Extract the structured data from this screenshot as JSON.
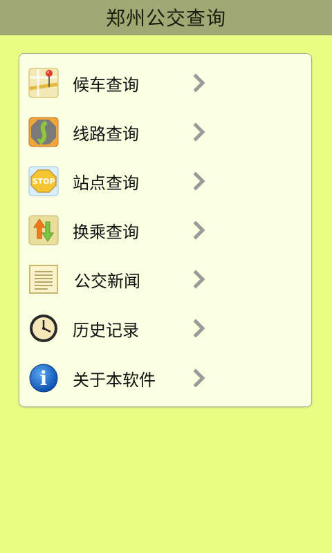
{
  "app": {
    "title": "郑州公交查询"
  },
  "menu": {
    "items": [
      {
        "label": "候车查询",
        "icon": "map-pin-icon"
      },
      {
        "label": "线路查询",
        "icon": "route-icon"
      },
      {
        "label": "站点查询",
        "icon": "stop-sign-icon",
        "icon_text": "STOP"
      },
      {
        "label": "换乘查询",
        "icon": "transfer-arrows-icon"
      },
      {
        "label": "公交新闻",
        "icon": "news-icon"
      },
      {
        "label": "历史记录",
        "icon": "clock-icon"
      },
      {
        "label": "关于本软件",
        "icon": "info-icon",
        "icon_text": "i"
      }
    ]
  },
  "colors": {
    "background": "#e8fc82",
    "titlebar": "#a0a874",
    "panel": "#fbffe2",
    "chevron": "#9a9a9a"
  }
}
